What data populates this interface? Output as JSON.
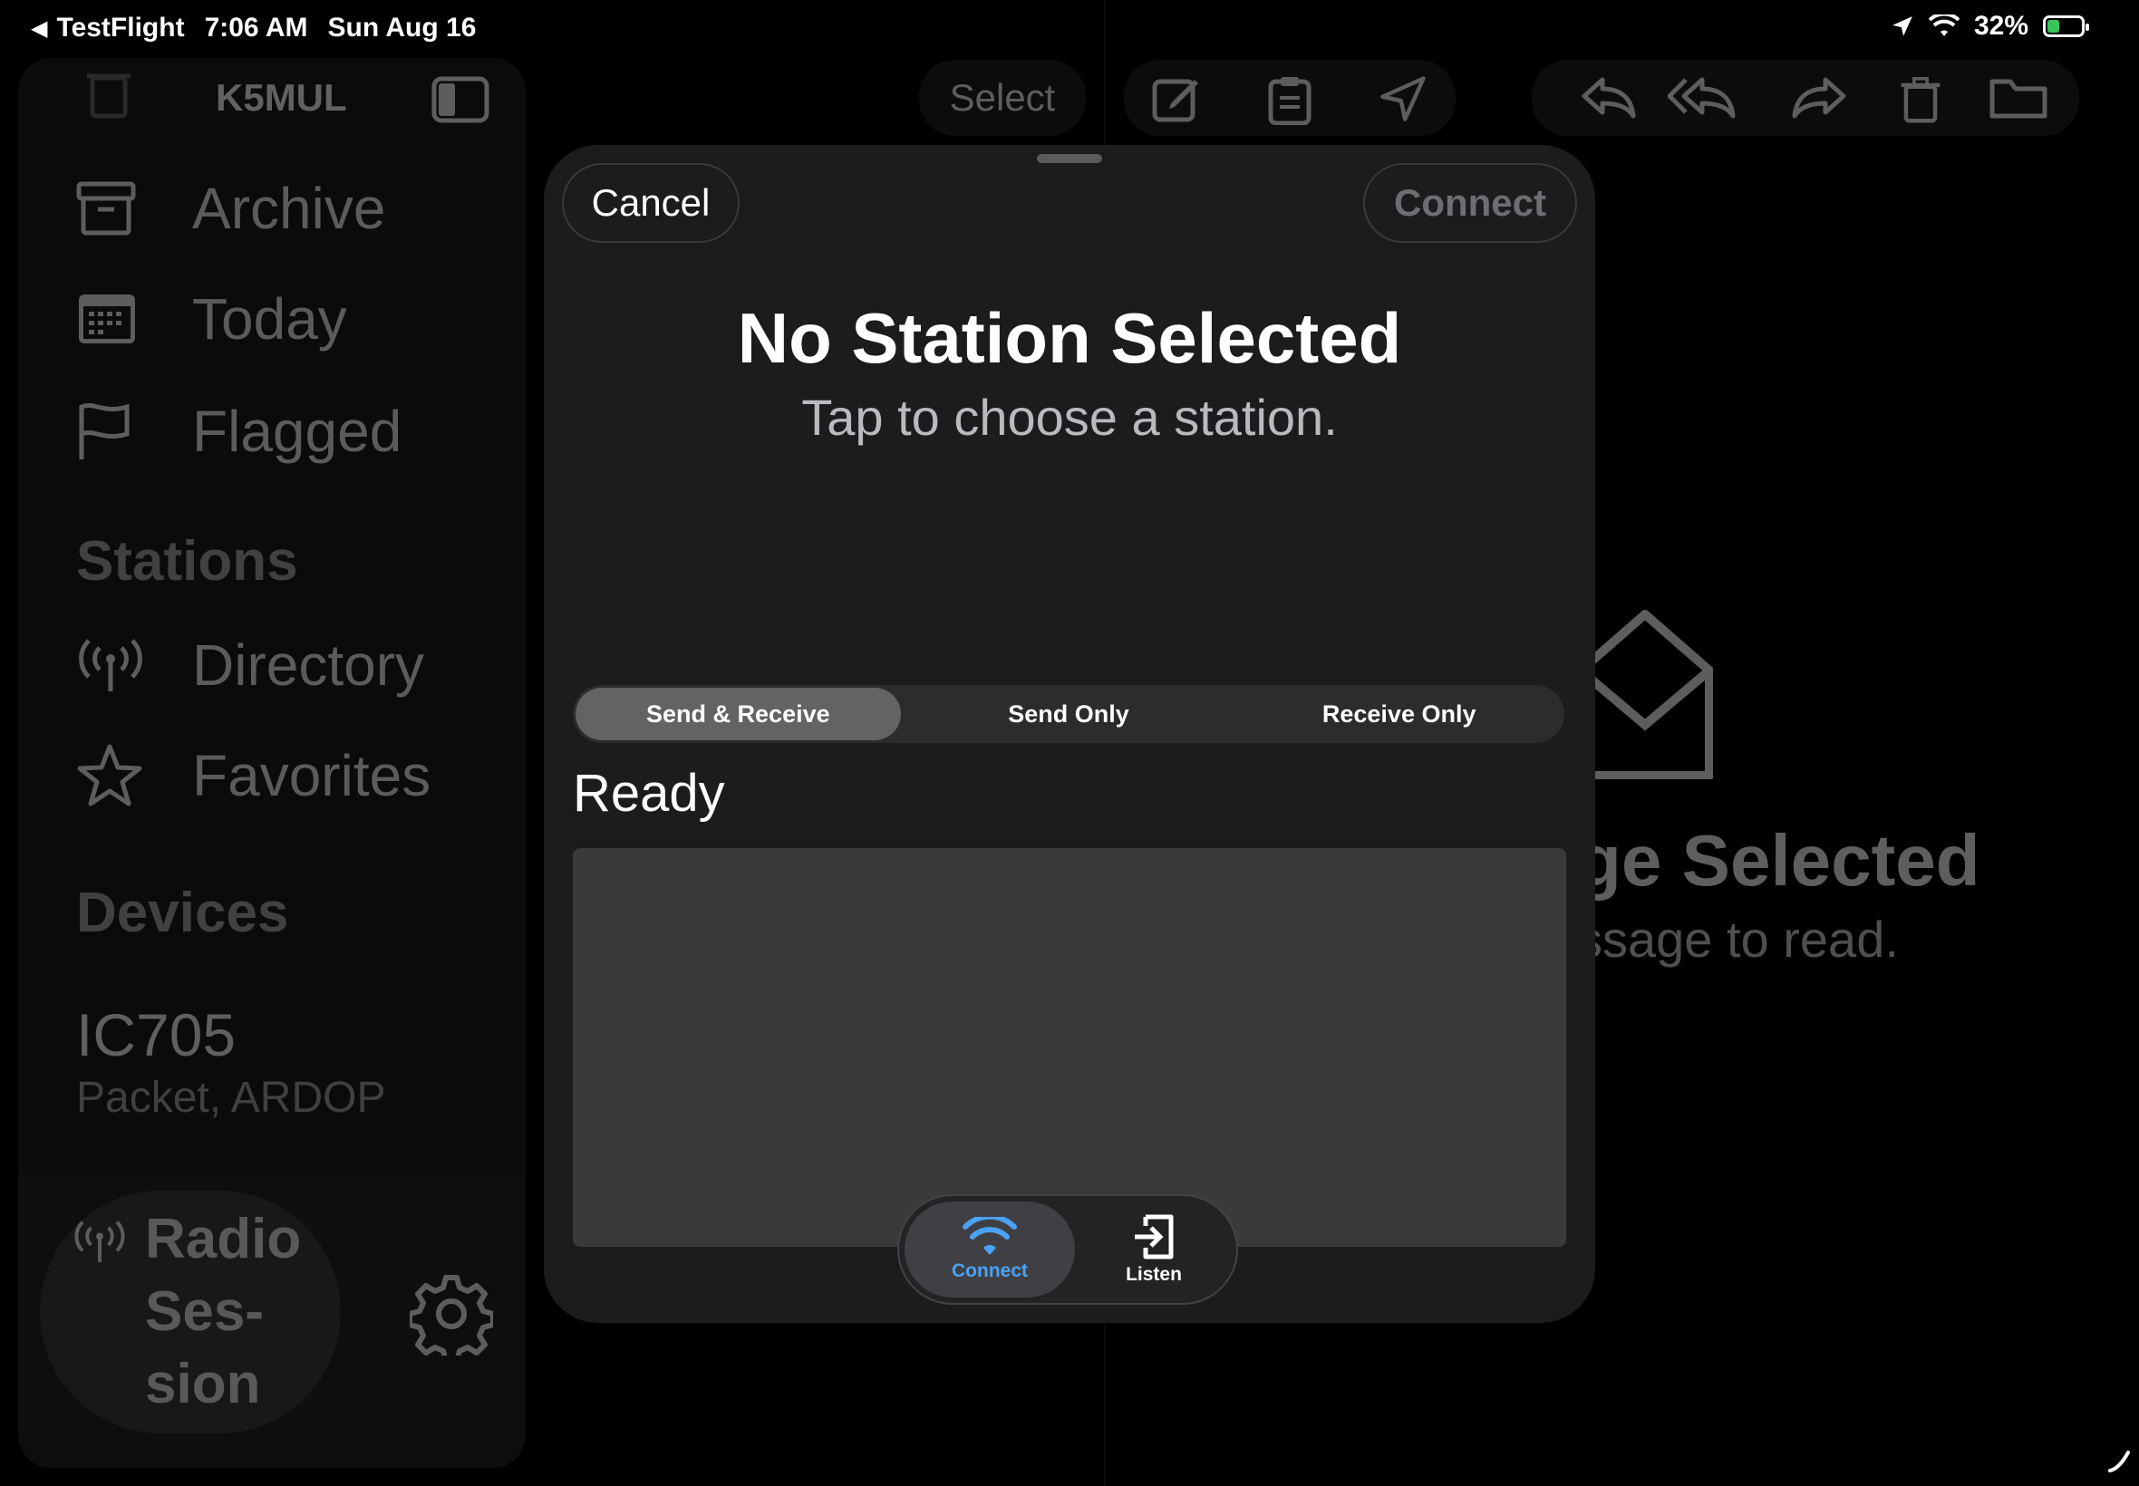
{
  "status_bar": {
    "back_app": "TestFlight",
    "time": "7:06 AM",
    "date": "Sun Aug 16",
    "battery": "32%"
  },
  "sidebar": {
    "account": "K5MUL",
    "items": [
      {
        "label": "Archive",
        "icon": "archive-box-icon"
      },
      {
        "label": "Today",
        "icon": "calendar-icon"
      },
      {
        "label": "Flagged",
        "icon": "flag-icon"
      }
    ],
    "stations_heading": "Stations",
    "station_items": [
      {
        "label": "Directory",
        "icon": "antenna-icon"
      },
      {
        "label": "Favorites",
        "icon": "star-icon"
      }
    ],
    "devices_heading": "Devices",
    "device": {
      "name": "IC705",
      "modes": "Packet, ARDOP"
    },
    "radio_session": {
      "line1": "Radio",
      "line2": "Ses-",
      "line3": "sion"
    }
  },
  "toolbar": {
    "select_label": "Select"
  },
  "detail": {
    "empty_title_partial": "ge Selected",
    "empty_sub_partial": "ssage to read."
  },
  "sheet": {
    "cancel_label": "Cancel",
    "connect_label": "Connect",
    "title": "No Station Selected",
    "subtitle": "Tap to choose a station.",
    "modes": [
      {
        "label": "Send & Receive",
        "selected": true
      },
      {
        "label": "Send Only",
        "selected": false
      },
      {
        "label": "Receive Only",
        "selected": false
      }
    ],
    "status": "Ready",
    "tabs": [
      {
        "label": "Connect",
        "icon": "wifi-icon",
        "selected": true
      },
      {
        "label": "Listen",
        "icon": "enter-icon",
        "selected": false
      }
    ]
  },
  "colors": {
    "accent": "#4aa3f6",
    "battery_green": "#35c759",
    "sheet_bg": "#1c1c1e"
  }
}
